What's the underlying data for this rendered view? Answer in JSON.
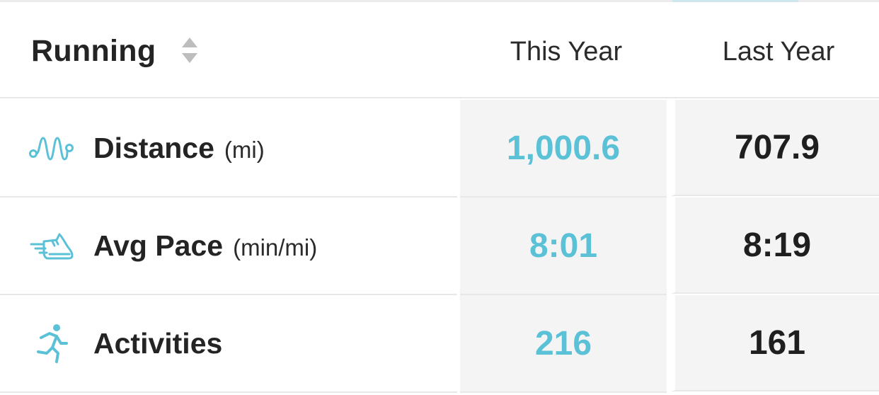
{
  "header": {
    "sport": "Running",
    "sort_icon": "sort-updown-icon",
    "col_this_year": "This Year",
    "col_last_year": "Last Year"
  },
  "colors": {
    "accent": "#5bc1d6",
    "text": "#242424",
    "value_bg": "#f4f4f4"
  },
  "rows": [
    {
      "name": "Distance",
      "unit": "(mi)",
      "icon": "route-icon",
      "this_year": "1,000.6",
      "last_year": "707.9"
    },
    {
      "name": "Avg Pace",
      "unit": "(min/mi)",
      "icon": "running-shoe-icon",
      "this_year": "8:01",
      "last_year": "8:19"
    },
    {
      "name": "Activities",
      "unit": "",
      "icon": "runner-icon",
      "this_year": "216",
      "last_year": "161"
    }
  ]
}
